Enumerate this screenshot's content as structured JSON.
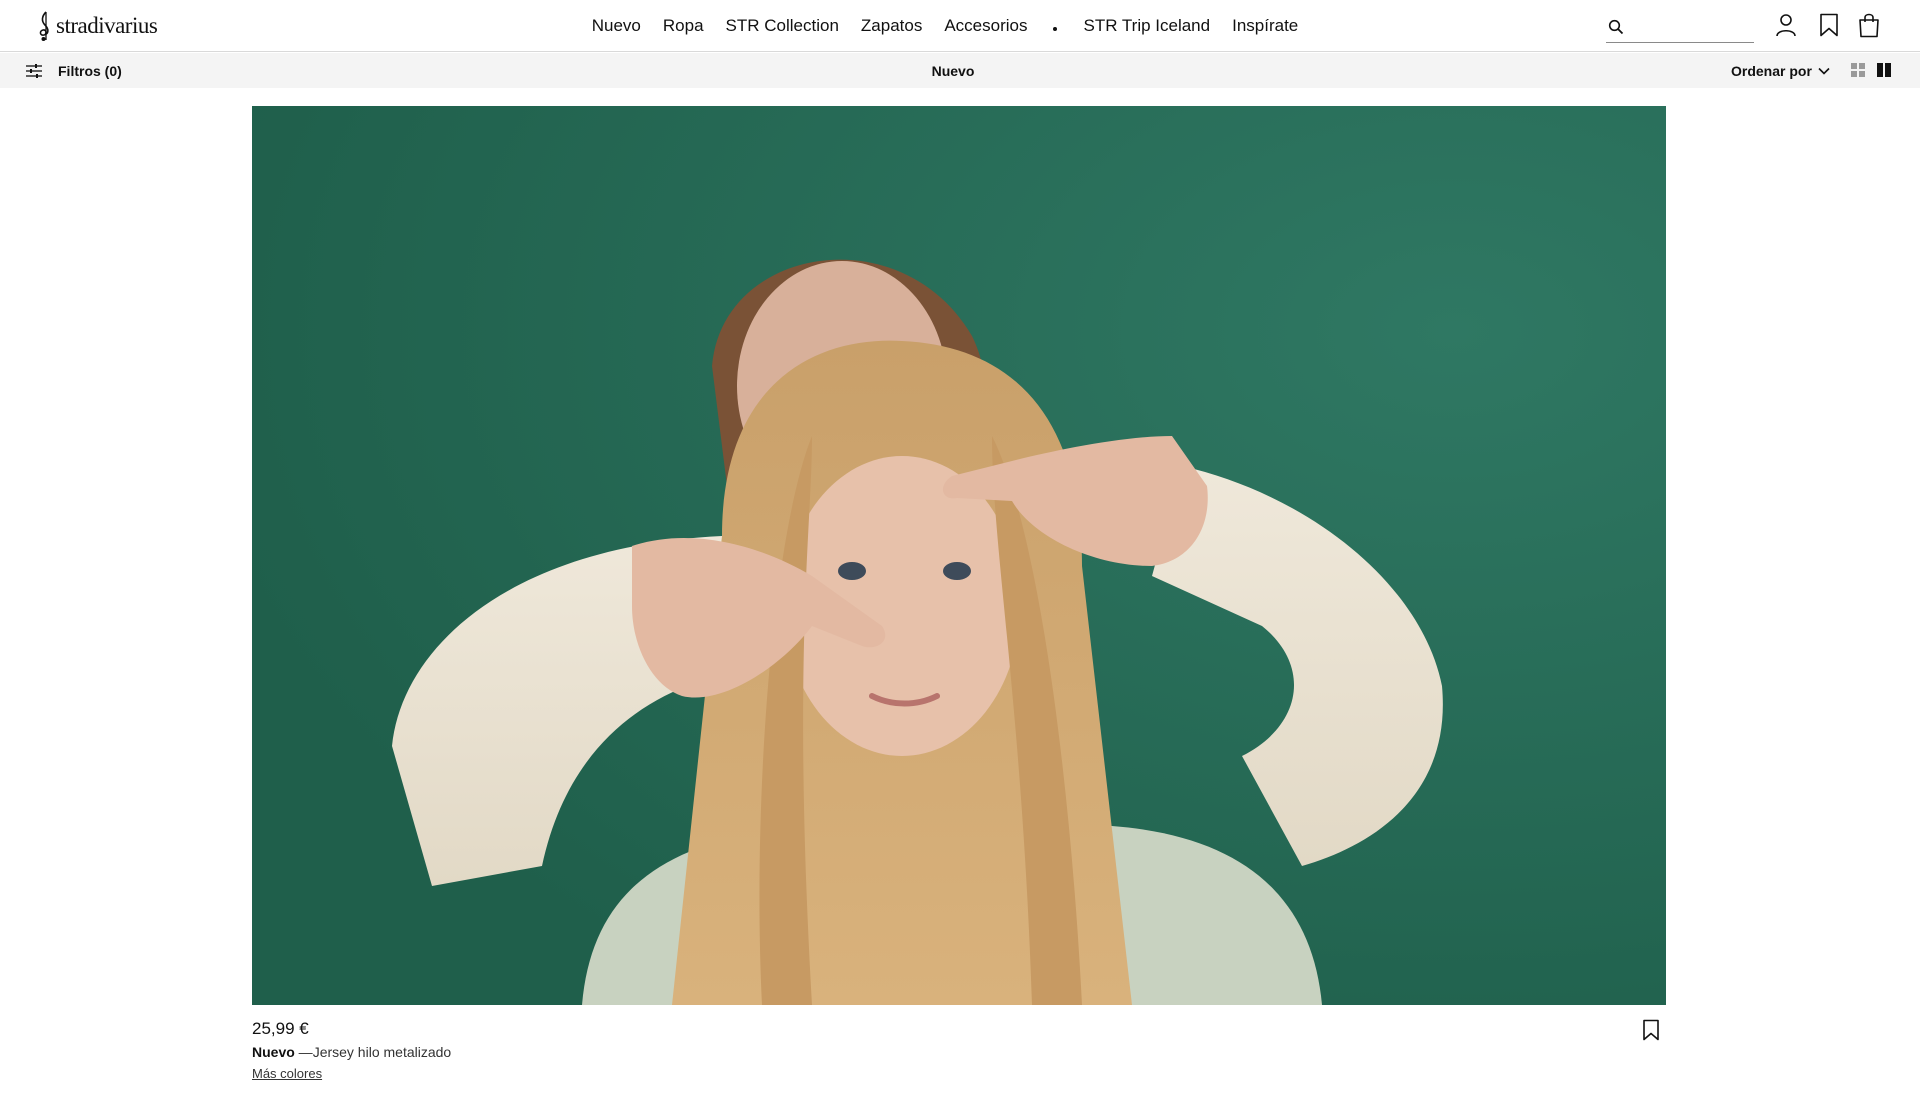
{
  "brand": {
    "logo_text": "stradivarius",
    "logo_icon": "treble-clef-logo-icon"
  },
  "nav": {
    "items": [
      {
        "label": "Nuevo"
      },
      {
        "label": "Ropa"
      },
      {
        "label": "STR Collection"
      },
      {
        "label": "Zapatos"
      },
      {
        "label": "Accesorios"
      },
      {
        "label": "STR Trip Iceland"
      },
      {
        "label": "Inspírate"
      }
    ]
  },
  "header": {
    "search_icon": "search-icon",
    "search_value": "",
    "account_icon": "user-icon",
    "wishlist_icon": "bookmark-icon",
    "cart_icon": "shopping-bag-icon"
  },
  "subbar": {
    "filters_label": "Filtros (0)",
    "filters_icon": "sliders-icon",
    "title": "Nuevo",
    "sort_label": "Ordenar por",
    "sort_icon": "chevron-down-icon",
    "view_icons": [
      "grid-small-icon",
      "grid-large-icon"
    ],
    "active_view": "grid-large-icon"
  },
  "product": {
    "image_alt": "",
    "price": "25,99 €",
    "tag": "Nuevo",
    "separator": " —",
    "name": "Jersey hilo metalizado",
    "more_colors": "Más colores",
    "save_icon": "bookmark-icon"
  },
  "colors": {
    "background": "#ffffff",
    "subbar": "#f4f4f4",
    "text": "#111111",
    "image_backdrop": "#246a55"
  }
}
